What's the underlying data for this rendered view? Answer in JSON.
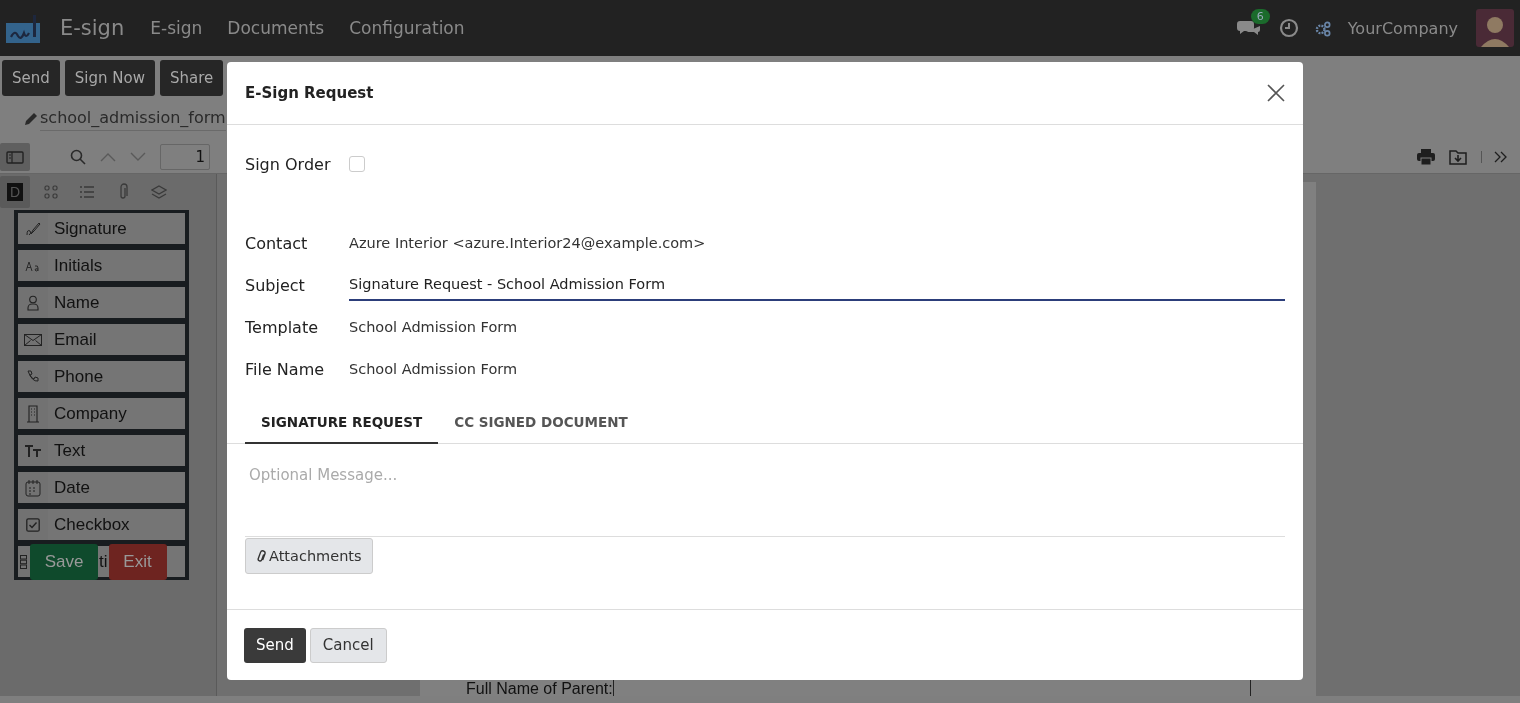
{
  "topbar": {
    "app_name": "E-sign",
    "menu": [
      "E-sign",
      "Documents",
      "Configuration"
    ],
    "chat_badge": "6",
    "company": "YourCompany"
  },
  "actions": [
    "Send",
    "Sign Now",
    "Share"
  ],
  "breadcrumb": "school_admission_form",
  "viewer": {
    "page": "1"
  },
  "sidebar_tabs": [
    {
      "kind": "text",
      "label": "D",
      "selected": true
    },
    {
      "kind": "thumbnails",
      "selected": false
    },
    {
      "kind": "outline",
      "selected": false
    },
    {
      "kind": "attachments",
      "selected": false
    },
    {
      "kind": "layers",
      "selected": false
    }
  ],
  "fields": [
    {
      "kind": "signature",
      "label": "Signature"
    },
    {
      "kind": "initials",
      "label": "Initials"
    },
    {
      "kind": "name",
      "label": "Name"
    },
    {
      "kind": "email",
      "label": "Email"
    },
    {
      "kind": "phone",
      "label": "Phone"
    },
    {
      "kind": "company",
      "label": "Company"
    },
    {
      "kind": "text",
      "label": "Text"
    },
    {
      "kind": "date",
      "label": "Date"
    },
    {
      "kind": "checkbox",
      "label": "Checkbox"
    },
    {
      "kind": "selection",
      "label": "ti"
    }
  ],
  "editor_buttons": [
    {
      "kind": "save",
      "label": "Save"
    },
    {
      "kind": "exit",
      "label": "Exit"
    }
  ],
  "document": {
    "label": "Full Name of Parent:"
  },
  "dialog": {
    "title": "E-Sign Request",
    "sign_order": {
      "label": "Sign Order",
      "checked": false
    },
    "fields": [
      {
        "kind": "text",
        "label": "Contact",
        "value": "Azure Interior <azure.Interior24@example.com>"
      },
      {
        "kind": "input",
        "label": "Subject",
        "value": "Signature Request - School Admission Form"
      },
      {
        "kind": "text",
        "label": "Template",
        "value": "School Admission Form"
      },
      {
        "kind": "text",
        "label": "File Name",
        "value": "School Admission Form"
      }
    ],
    "tabs": [
      {
        "label": "SIGNATURE REQUEST",
        "selected": true
      },
      {
        "label": "CC SIGNED DOCUMENT",
        "selected": false
      }
    ],
    "message": {
      "placeholder": "Optional Message..."
    },
    "attachments": "Attachments",
    "buttons": [
      {
        "kind": "primary",
        "label": "Send"
      },
      {
        "kind": "secondary",
        "label": "Cancel"
      }
    ]
  }
}
